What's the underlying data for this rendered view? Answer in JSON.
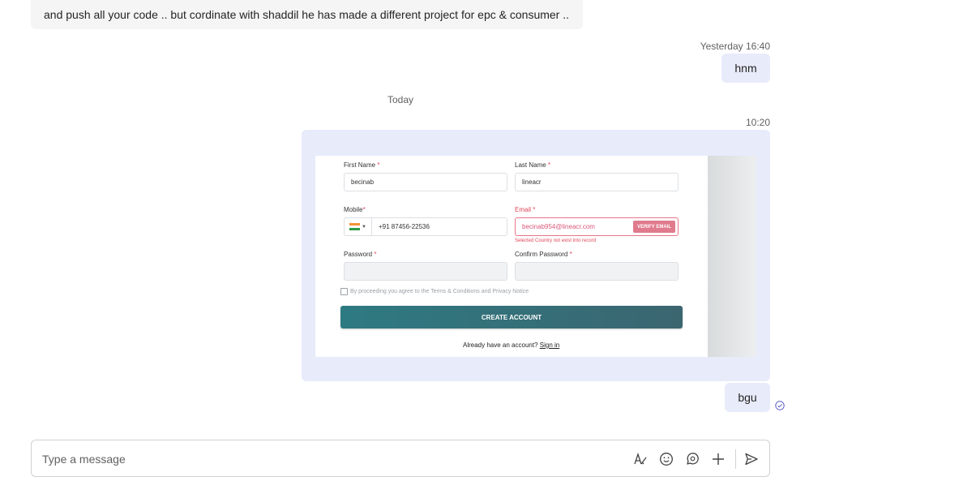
{
  "messages": {
    "incoming_text": "and push all your code .. but cordinate with shaddil he has made a different project for epc & consumer ..",
    "yesterday_time": "Yesterday 16:40",
    "out_hnm": "hnm",
    "today_divider": "Today",
    "time_1020": "10:20",
    "out_bgu": "bgu"
  },
  "form_screenshot": {
    "first_name_label": "First Name",
    "first_name_value": "becinab",
    "last_name_label": "Last Name",
    "last_name_value": "lineacr",
    "mobile_label": "Mobile",
    "mobile_value": "+91 87456-22536",
    "email_label": "Email",
    "email_value": "becinab954@lineacr.com",
    "verify_label": "VERIFY EMAIL",
    "email_error": "Selected Country not exist into record",
    "password_label": "Password",
    "confirm_password_label": "Confirm Password",
    "terms_text": "By proceeding you agree to the Terms & Conditions and Privacy Notice",
    "create_account_label": "CREATE ACCOUNT",
    "already_text": "Already have an account?",
    "sign_in_label": "Sign in",
    "required_mark": "*"
  },
  "composer": {
    "placeholder": "Type a message"
  },
  "icons": [
    "format-icon",
    "emoji-icon",
    "loop-icon",
    "plus-icon",
    "send-icon",
    "seen-check-icon"
  ],
  "colors": {
    "outgoing_bubble": "#e8ebfa",
    "incoming_bubble": "#f5f5f5",
    "create_button": "#2e7a82",
    "error": "#e0475b"
  }
}
